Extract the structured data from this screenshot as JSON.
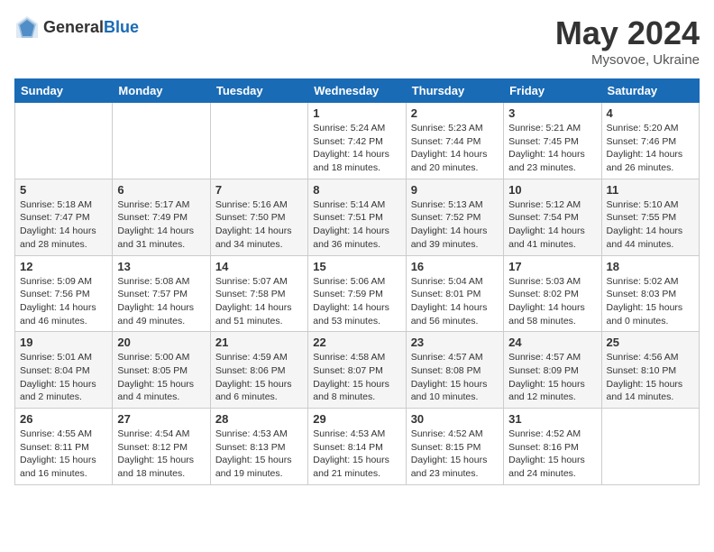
{
  "logo": {
    "general": "General",
    "blue": "Blue"
  },
  "header": {
    "month": "May 2024",
    "location": "Mysovoe, Ukraine"
  },
  "weekdays": [
    "Sunday",
    "Monday",
    "Tuesday",
    "Wednesday",
    "Thursday",
    "Friday",
    "Saturday"
  ],
  "weeks": [
    [
      {
        "day": "",
        "info": ""
      },
      {
        "day": "",
        "info": ""
      },
      {
        "day": "",
        "info": ""
      },
      {
        "day": "1",
        "info": "Sunrise: 5:24 AM\nSunset: 7:42 PM\nDaylight: 14 hours\nand 18 minutes."
      },
      {
        "day": "2",
        "info": "Sunrise: 5:23 AM\nSunset: 7:44 PM\nDaylight: 14 hours\nand 20 minutes."
      },
      {
        "day": "3",
        "info": "Sunrise: 5:21 AM\nSunset: 7:45 PM\nDaylight: 14 hours\nand 23 minutes."
      },
      {
        "day": "4",
        "info": "Sunrise: 5:20 AM\nSunset: 7:46 PM\nDaylight: 14 hours\nand 26 minutes."
      }
    ],
    [
      {
        "day": "5",
        "info": "Sunrise: 5:18 AM\nSunset: 7:47 PM\nDaylight: 14 hours\nand 28 minutes."
      },
      {
        "day": "6",
        "info": "Sunrise: 5:17 AM\nSunset: 7:49 PM\nDaylight: 14 hours\nand 31 minutes."
      },
      {
        "day": "7",
        "info": "Sunrise: 5:16 AM\nSunset: 7:50 PM\nDaylight: 14 hours\nand 34 minutes."
      },
      {
        "day": "8",
        "info": "Sunrise: 5:14 AM\nSunset: 7:51 PM\nDaylight: 14 hours\nand 36 minutes."
      },
      {
        "day": "9",
        "info": "Sunrise: 5:13 AM\nSunset: 7:52 PM\nDaylight: 14 hours\nand 39 minutes."
      },
      {
        "day": "10",
        "info": "Sunrise: 5:12 AM\nSunset: 7:54 PM\nDaylight: 14 hours\nand 41 minutes."
      },
      {
        "day": "11",
        "info": "Sunrise: 5:10 AM\nSunset: 7:55 PM\nDaylight: 14 hours\nand 44 minutes."
      }
    ],
    [
      {
        "day": "12",
        "info": "Sunrise: 5:09 AM\nSunset: 7:56 PM\nDaylight: 14 hours\nand 46 minutes."
      },
      {
        "day": "13",
        "info": "Sunrise: 5:08 AM\nSunset: 7:57 PM\nDaylight: 14 hours\nand 49 minutes."
      },
      {
        "day": "14",
        "info": "Sunrise: 5:07 AM\nSunset: 7:58 PM\nDaylight: 14 hours\nand 51 minutes."
      },
      {
        "day": "15",
        "info": "Sunrise: 5:06 AM\nSunset: 7:59 PM\nDaylight: 14 hours\nand 53 minutes."
      },
      {
        "day": "16",
        "info": "Sunrise: 5:04 AM\nSunset: 8:01 PM\nDaylight: 14 hours\nand 56 minutes."
      },
      {
        "day": "17",
        "info": "Sunrise: 5:03 AM\nSunset: 8:02 PM\nDaylight: 14 hours\nand 58 minutes."
      },
      {
        "day": "18",
        "info": "Sunrise: 5:02 AM\nSunset: 8:03 PM\nDaylight: 15 hours\nand 0 minutes."
      }
    ],
    [
      {
        "day": "19",
        "info": "Sunrise: 5:01 AM\nSunset: 8:04 PM\nDaylight: 15 hours\nand 2 minutes."
      },
      {
        "day": "20",
        "info": "Sunrise: 5:00 AM\nSunset: 8:05 PM\nDaylight: 15 hours\nand 4 minutes."
      },
      {
        "day": "21",
        "info": "Sunrise: 4:59 AM\nSunset: 8:06 PM\nDaylight: 15 hours\nand 6 minutes."
      },
      {
        "day": "22",
        "info": "Sunrise: 4:58 AM\nSunset: 8:07 PM\nDaylight: 15 hours\nand 8 minutes."
      },
      {
        "day": "23",
        "info": "Sunrise: 4:57 AM\nSunset: 8:08 PM\nDaylight: 15 hours\nand 10 minutes."
      },
      {
        "day": "24",
        "info": "Sunrise: 4:57 AM\nSunset: 8:09 PM\nDaylight: 15 hours\nand 12 minutes."
      },
      {
        "day": "25",
        "info": "Sunrise: 4:56 AM\nSunset: 8:10 PM\nDaylight: 15 hours\nand 14 minutes."
      }
    ],
    [
      {
        "day": "26",
        "info": "Sunrise: 4:55 AM\nSunset: 8:11 PM\nDaylight: 15 hours\nand 16 minutes."
      },
      {
        "day": "27",
        "info": "Sunrise: 4:54 AM\nSunset: 8:12 PM\nDaylight: 15 hours\nand 18 minutes."
      },
      {
        "day": "28",
        "info": "Sunrise: 4:53 AM\nSunset: 8:13 PM\nDaylight: 15 hours\nand 19 minutes."
      },
      {
        "day": "29",
        "info": "Sunrise: 4:53 AM\nSunset: 8:14 PM\nDaylight: 15 hours\nand 21 minutes."
      },
      {
        "day": "30",
        "info": "Sunrise: 4:52 AM\nSunset: 8:15 PM\nDaylight: 15 hours\nand 23 minutes."
      },
      {
        "day": "31",
        "info": "Sunrise: 4:52 AM\nSunset: 8:16 PM\nDaylight: 15 hours\nand 24 minutes."
      },
      {
        "day": "",
        "info": ""
      }
    ]
  ]
}
